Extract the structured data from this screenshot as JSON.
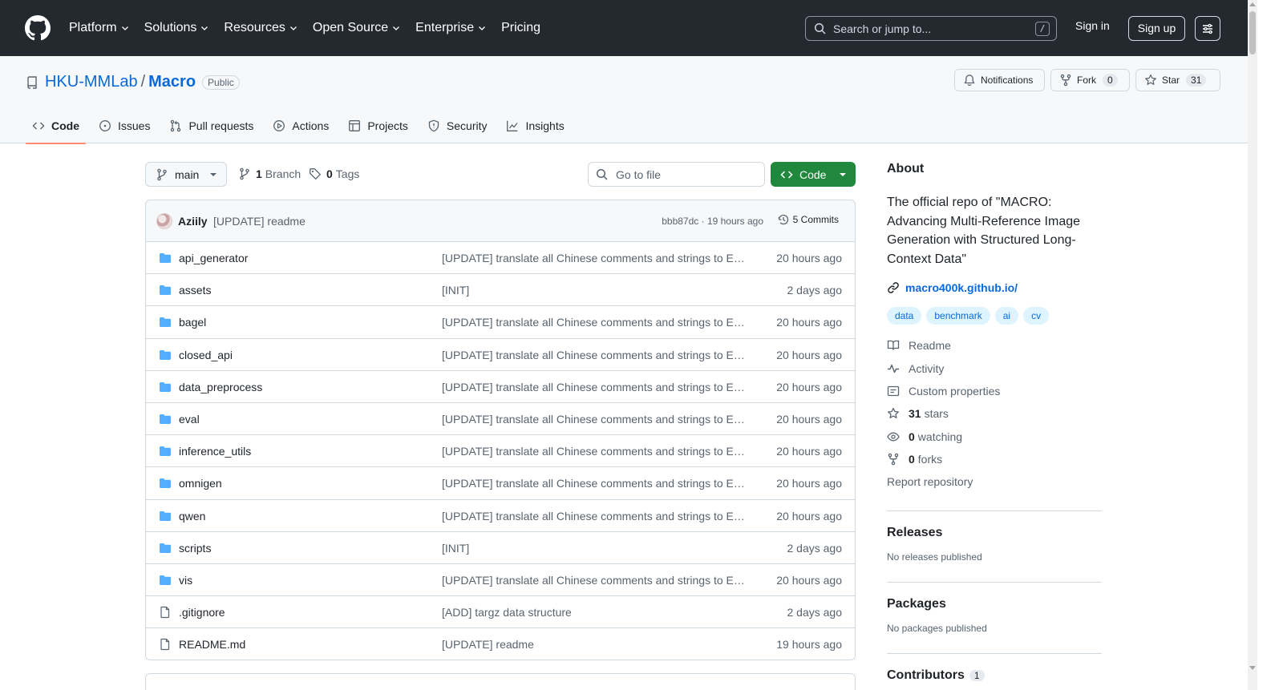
{
  "header": {
    "nav": [
      "Platform",
      "Solutions",
      "Resources",
      "Open Source",
      "Enterprise",
      "Pricing"
    ],
    "nav_has_dropdown": [
      true,
      true,
      true,
      true,
      true,
      false
    ],
    "search_placeholder": "Search or jump to...",
    "search_shortcut": "/",
    "signin": "Sign in",
    "signup": "Sign up",
    "bg_color": "#24292f"
  },
  "repo": {
    "owner": "HKU-MMLab",
    "name": "Macro",
    "visibility": "Public",
    "notifications_label": "Notifications",
    "fork_label": "Fork",
    "fork_count": "0",
    "star_label": "Star",
    "star_count": "31"
  },
  "tabs": [
    {
      "label": "Code",
      "icon": "code-icon",
      "active": true
    },
    {
      "label": "Issues",
      "icon": "issue-icon",
      "active": false
    },
    {
      "label": "Pull requests",
      "icon": "pull-request-icon",
      "active": false
    },
    {
      "label": "Actions",
      "icon": "play-icon",
      "active": false
    },
    {
      "label": "Projects",
      "icon": "table-icon",
      "active": false
    },
    {
      "label": "Security",
      "icon": "shield-icon",
      "active": false
    },
    {
      "label": "Insights",
      "icon": "graph-icon",
      "active": false
    }
  ],
  "toolbar": {
    "branch": "main",
    "branch_count": "1",
    "branch_label": "Branch",
    "tag_count": "0",
    "tag_label": "Tags",
    "goto_placeholder": "Go to file",
    "code_button": "Code",
    "accent": "#1f883d"
  },
  "commit": {
    "author": "Aziily",
    "message": "[UPDATE] readme",
    "sha_time": "bbb87dc · 19 hours ago",
    "commits_label": "5 Commits"
  },
  "files": [
    {
      "name": "api_generator",
      "type": "folder",
      "message": "[UPDATE] translate all Chinese comments and strings to English",
      "time": "20 hours ago"
    },
    {
      "name": "assets",
      "type": "folder",
      "message": "[INIT]",
      "time": "2 days ago"
    },
    {
      "name": "bagel",
      "type": "folder",
      "message": "[UPDATE] translate all Chinese comments and strings to English",
      "time": "20 hours ago"
    },
    {
      "name": "closed_api",
      "type": "folder",
      "message": "[UPDATE] translate all Chinese comments and strings to English",
      "time": "20 hours ago"
    },
    {
      "name": "data_preprocess",
      "type": "folder",
      "message": "[UPDATE] translate all Chinese comments and strings to English",
      "time": "20 hours ago"
    },
    {
      "name": "eval",
      "type": "folder",
      "message": "[UPDATE] translate all Chinese comments and strings to English",
      "time": "20 hours ago"
    },
    {
      "name": "inference_utils",
      "type": "folder",
      "message": "[UPDATE] translate all Chinese comments and strings to English",
      "time": "20 hours ago"
    },
    {
      "name": "omnigen",
      "type": "folder",
      "message": "[UPDATE] translate all Chinese comments and strings to English",
      "time": "20 hours ago"
    },
    {
      "name": "qwen",
      "type": "folder",
      "message": "[UPDATE] translate all Chinese comments and strings to English",
      "time": "20 hours ago"
    },
    {
      "name": "scripts",
      "type": "folder",
      "message": "[INIT]",
      "time": "2 days ago"
    },
    {
      "name": "vis",
      "type": "folder",
      "message": "[UPDATE] translate all Chinese comments and strings to English",
      "time": "20 hours ago"
    },
    {
      "name": ".gitignore",
      "type": "file",
      "message": "[ADD] targz data structure",
      "time": "2 days ago"
    },
    {
      "name": "README.md",
      "type": "file",
      "message": "[UPDATE] readme",
      "time": "19 hours ago"
    }
  ],
  "about": {
    "title": "About",
    "description": "The official repo of \"MACRO: Advancing Multi-Reference Image Generation with Structured Long-Context Data\"",
    "website": "macro400k.github.io/",
    "topics": [
      "data",
      "benchmark",
      "ai",
      "cv"
    ],
    "items": [
      {
        "icon": "book-icon",
        "count": "",
        "label": "Readme"
      },
      {
        "icon": "pulse-icon",
        "count": "",
        "label": "Activity"
      },
      {
        "icon": "note-icon",
        "count": "",
        "label": "Custom properties"
      },
      {
        "icon": "star-icon",
        "count": "31",
        "label": "stars"
      },
      {
        "icon": "eye-icon",
        "count": "0",
        "label": "watching"
      },
      {
        "icon": "fork-icon",
        "count": "0",
        "label": "forks"
      }
    ],
    "report": "Report repository"
  },
  "releases": {
    "title": "Releases",
    "empty": "No releases published"
  },
  "packages": {
    "title": "Packages",
    "empty": "No packages published"
  },
  "contributors": {
    "title": "Contributors",
    "count": "1"
  }
}
